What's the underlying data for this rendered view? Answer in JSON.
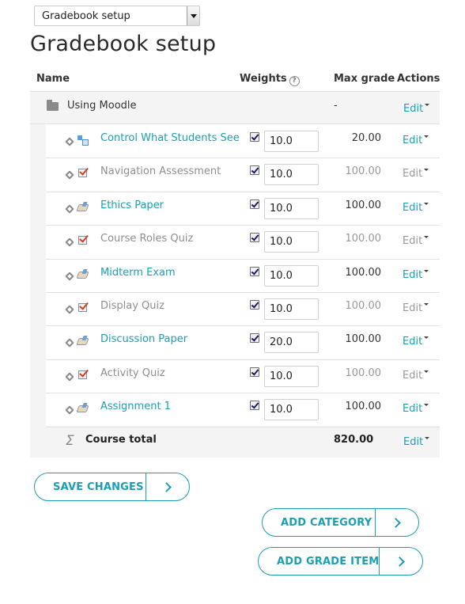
{
  "selector": {
    "value": "Gradebook setup"
  },
  "page_title": "Gradebook setup",
  "table": {
    "headers": {
      "name": "Name",
      "weights": "Weights",
      "max_grade": "Max grade",
      "actions": "Actions"
    },
    "category": {
      "name": "Using Moodle",
      "max_grade": "-",
      "edit": "Edit"
    },
    "items": [
      {
        "name": "Control What Students See",
        "icon": "lesson-icon",
        "hidden": false,
        "weight": "10.0",
        "max_grade": "20.00",
        "edit": "Edit"
      },
      {
        "name": "Navigation Assessment",
        "icon": "quiz-icon",
        "hidden": true,
        "weight": "10.0",
        "max_grade": "100.00",
        "edit": "Edit"
      },
      {
        "name": "Ethics Paper",
        "icon": "assignment-icon",
        "hidden": false,
        "weight": "10.0",
        "max_grade": "100.00",
        "edit": "Edit"
      },
      {
        "name": "Course Roles Quiz",
        "icon": "quiz-icon",
        "hidden": true,
        "weight": "10.0",
        "max_grade": "100.00",
        "edit": "Edit"
      },
      {
        "name": "Midterm Exam",
        "icon": "assignment-icon",
        "hidden": false,
        "weight": "10.0",
        "max_grade": "100.00",
        "edit": "Edit"
      },
      {
        "name": "Display Quiz",
        "icon": "quiz-icon",
        "hidden": true,
        "weight": "10.0",
        "max_grade": "100.00",
        "edit": "Edit"
      },
      {
        "name": "Discussion Paper",
        "icon": "assignment-icon",
        "hidden": false,
        "weight": "20.0",
        "max_grade": "100.00",
        "edit": "Edit"
      },
      {
        "name": "Activity Quiz",
        "icon": "quiz-icon",
        "hidden": true,
        "weight": "10.0",
        "max_grade": "100.00",
        "edit": "Edit"
      },
      {
        "name": "Assignment 1",
        "icon": "assignment-icon",
        "hidden": false,
        "weight": "10.0",
        "max_grade": "100.00",
        "edit": "Edit"
      }
    ],
    "total": {
      "label": "Course total",
      "max_grade": "820.00",
      "edit": "Edit"
    }
  },
  "buttons": {
    "save": "SAVE CHANGES",
    "add_category": "ADD CATEGORY",
    "add_grade_item": "ADD GRADE ITEM"
  },
  "colors": {
    "accent": "#1a9fb4",
    "hidden_text": "#8f8f8f"
  }
}
